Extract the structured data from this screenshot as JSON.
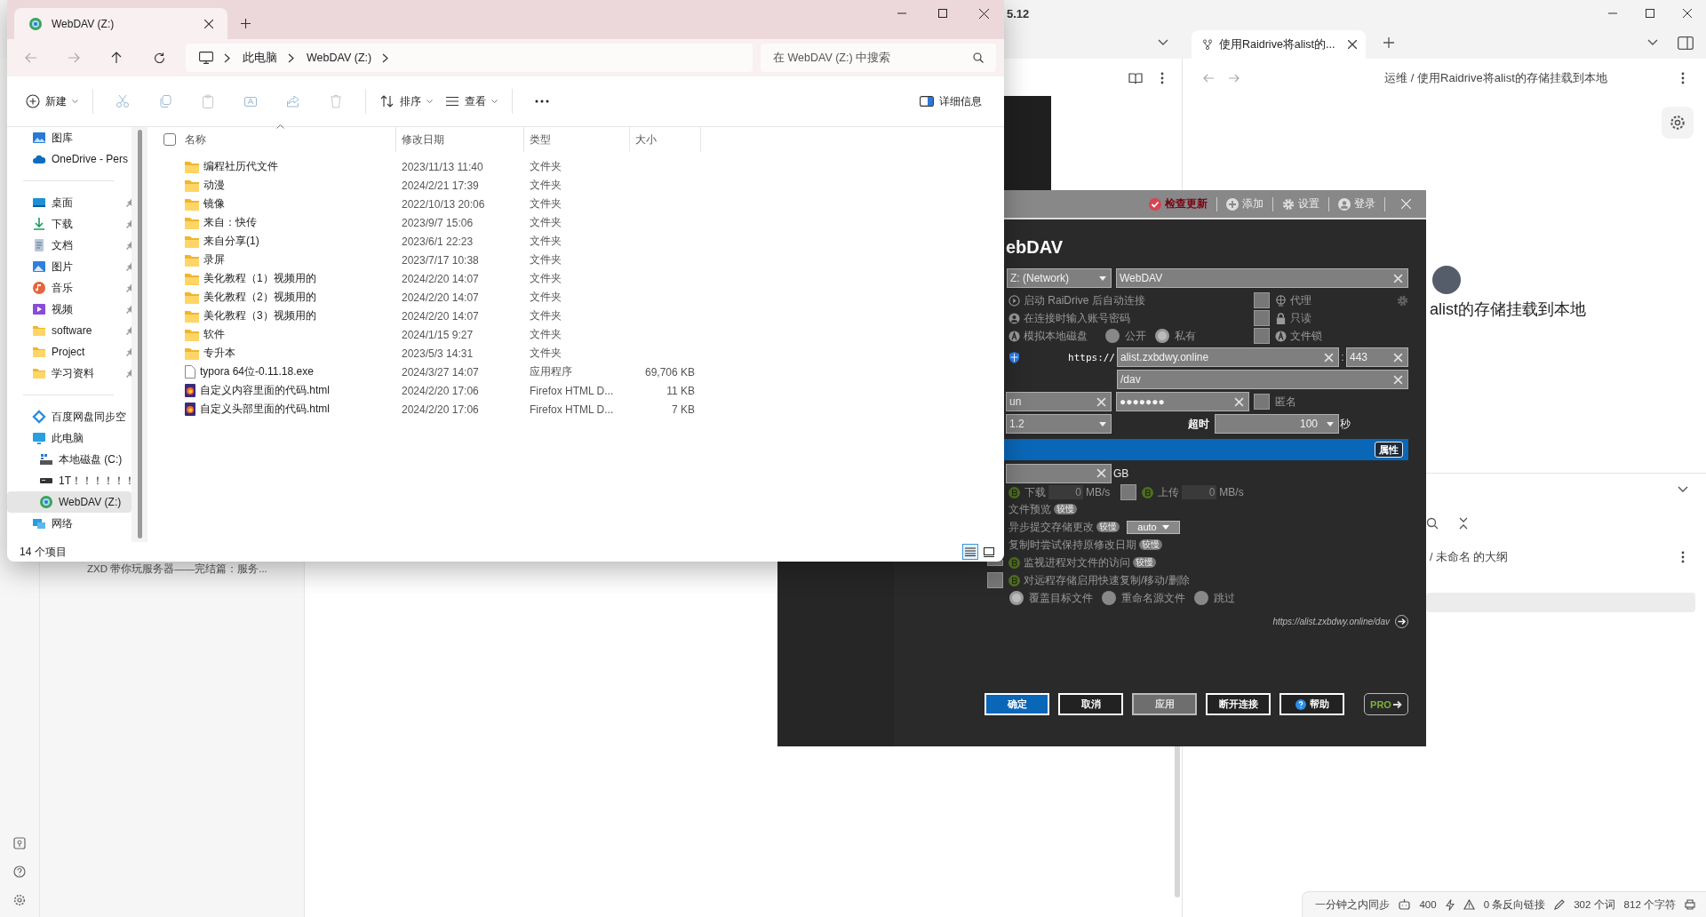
{
  "obsidian": {
    "version": "5.12",
    "tab": "使用Raidrive将alist的...",
    "breadcrumb": "运维 / 使用Raidrive将alist的存储挂载到本地",
    "note_title": "alist的存储挂载到本地",
    "file_item": "ZXD 带你玩服务器——完结篇：服务...",
    "outline_path": "/ 未命名 的大纲",
    "status": {
      "sync": "一分钟之内同步",
      "count": "400",
      "backlinks": "0 条反向链接",
      "words": "302 个词",
      "chars": "812 个字符"
    }
  },
  "explorer": {
    "tab_title": "WebDAV (Z:)",
    "path": [
      "此电脑",
      "WebDAV (Z:)"
    ],
    "search": {
      "placeholder": "在 WebDAV (Z:) 中搜索"
    },
    "toolbar": {
      "new": "新建",
      "sort": "排序",
      "view": "查看",
      "details": "详细信息"
    },
    "nav": [
      {
        "items": [
          {
            "label": "图库",
            "kind": "gallery",
            "pinned": false,
            "selected": false
          },
          {
            "label": "OneDrive - Pers",
            "kind": "cloud",
            "pinned": false,
            "selected": false
          }
        ]
      },
      {
        "items": [
          {
            "label": "桌面",
            "kind": "desktop",
            "pinned": true,
            "selected": false
          },
          {
            "label": "下载",
            "kind": "download",
            "pinned": true,
            "selected": false
          },
          {
            "label": "文档",
            "kind": "document",
            "pinned": true,
            "selected": false
          },
          {
            "label": "图片",
            "kind": "picture",
            "pinned": true,
            "selected": false
          },
          {
            "label": "音乐",
            "kind": "music",
            "pinned": true,
            "selected": false
          },
          {
            "label": "视频",
            "kind": "video",
            "pinned": true,
            "selected": false
          },
          {
            "label": "software",
            "kind": "folder",
            "pinned": true,
            "selected": false
          },
          {
            "label": "Project",
            "kind": "folder",
            "pinned": true,
            "selected": false
          },
          {
            "label": "学习资料",
            "kind": "folder",
            "pinned": true,
            "selected": false
          }
        ]
      },
      {
        "items": [
          {
            "label": "百度网盘同步空",
            "kind": "baidu",
            "pinned": false,
            "selected": false
          },
          {
            "label": "此电脑",
            "kind": "pc",
            "pinned": false,
            "selected": false,
            "children": [
              {
                "label": "本地磁盘 (C:)",
                "kind": "drive",
                "pinned": false,
                "selected": false
              },
              {
                "label": "1T！！！！！！",
                "kind": "usb",
                "pinned": false,
                "selected": false
              },
              {
                "label": "WebDAV (Z:)",
                "kind": "webdav",
                "pinned": false,
                "selected": true
              }
            ]
          },
          {
            "label": "网络",
            "kind": "network",
            "pinned": false,
            "selected": false
          }
        ]
      }
    ],
    "select_all": {
      "checked": false
    },
    "columns": [
      "名称",
      "修改日期",
      "类型",
      "大小"
    ],
    "rows": [
      {
        "name": "编程社历代文件",
        "date": "2023/11/13 11:40",
        "type": "文件夹",
        "kind": "folder"
      },
      {
        "name": "动漫",
        "date": "2024/2/21 17:39",
        "type": "文件夹",
        "kind": "folder"
      },
      {
        "name": "镜像",
        "date": "2022/10/13 20:06",
        "type": "文件夹",
        "kind": "folder"
      },
      {
        "name": "来自：快传",
        "date": "2023/9/7 15:06",
        "type": "文件夹",
        "kind": "folder"
      },
      {
        "name": "来自分享(1)",
        "date": "2023/6/1 22:23",
        "type": "文件夹",
        "kind": "folder"
      },
      {
        "name": "录屏",
        "date": "2023/7/17 10:38",
        "type": "文件夹",
        "kind": "folder"
      },
      {
        "name": "美化教程（1）视频用的",
        "date": "2024/2/20 14:07",
        "type": "文件夹",
        "kind": "folder"
      },
      {
        "name": "美化教程（2）视频用的",
        "date": "2024/2/20 14:07",
        "type": "文件夹",
        "kind": "folder"
      },
      {
        "name": "美化教程（3）视频用的",
        "date": "2024/2/20 14:07",
        "type": "文件夹",
        "kind": "folder"
      },
      {
        "name": "软件",
        "date": "2024/1/15 9:27",
        "type": "文件夹",
        "kind": "folder"
      },
      {
        "name": "专升本",
        "date": "2023/5/3 14:31",
        "type": "文件夹",
        "kind": "folder"
      },
      {
        "name": "typora 64位-0.11.18.exe",
        "date": "2024/3/27 14:07",
        "type": "应用程序",
        "size": "69,706 KB",
        "kind": "exe"
      },
      {
        "name": "自定义内容里面的代码.html",
        "date": "2024/2/20 17:06",
        "type": "Firefox HTML D...",
        "size": "11 KB",
        "kind": "html"
      },
      {
        "name": "自定义头部里面的代码.html",
        "date": "2024/2/20 17:06",
        "type": "Firefox HTML D...",
        "size": "7 KB",
        "kind": "html"
      }
    ],
    "status": "14 个项目",
    "views": [
      {
        "kind": "details",
        "selected": true
      },
      {
        "kind": "tiles",
        "selected": false
      }
    ]
  },
  "raidrive": {
    "toolbar": [
      {
        "label": "检查更新",
        "kind": "update"
      },
      {
        "label": "添加",
        "kind": "add"
      },
      {
        "label": "设置",
        "kind": "settings"
      },
      {
        "label": "登录",
        "kind": "login"
      }
    ],
    "title": "ebDAV",
    "drive": "Z: (Network)",
    "name": "WebDAV",
    "options": [
      {
        "label": "启动 RaiDrive 后自动连接",
        "kind": "play",
        "right": {
          "label": "代理",
          "kind": "globe",
          "checked": false
        }
      },
      {
        "label": "在连接时输入账号密码",
        "kind": "user",
        "right": {
          "label": "只读",
          "kind": "lock",
          "checked": false
        }
      },
      {
        "label": "模拟本地磁盘",
        "kind": "a",
        "right": {
          "label": "文件锁",
          "kind": "a",
          "checked": false
        }
      }
    ],
    "visibility": [
      {
        "label": "公开",
        "selected": false
      },
      {
        "label": "私有",
        "selected": true
      }
    ],
    "scheme": "https://",
    "host": "alist.zxbdwy.online",
    "port_separator": ":",
    "port": "443",
    "path": "/dav",
    "user": "un",
    "password": "●●●●●●●",
    "anonymous": {
      "label": "匿名",
      "checked": false
    },
    "version": "1.2",
    "timeout_label": "超时",
    "timeout": "100",
    "timeout_unit": "秒",
    "properties": "属性",
    "quota_unit": "GB",
    "download": {
      "label": "下载",
      "value": "0",
      "unit": "MB/s"
    },
    "upload_checked": false,
    "upload": {
      "label": "上传",
      "value": "0",
      "unit": "MB/s"
    },
    "advanced": [
      {
        "kind": "plain",
        "label": "文件预览",
        "badge": "较慢"
      },
      {
        "kind": "select",
        "label": "异步提交存储更改",
        "badge": "较慢",
        "value": "auto"
      },
      {
        "kind": "plain",
        "label": "复制时尝试保持原修改日期",
        "badge": "较慢"
      },
      {
        "kind": "check",
        "label": "监视进程对文件的访问",
        "badge": "较慢",
        "checked": false
      },
      {
        "kind": "check",
        "label": "对远程存储启用快速复制/移动/删除",
        "checked": false
      }
    ],
    "conflict": [
      {
        "label": "覆盖目标文件",
        "selected": true
      },
      {
        "label": "重命名源文件",
        "selected": false
      },
      {
        "label": "跳过",
        "selected": false
      }
    ],
    "url": "https://alist.zxbdwy.online/dav",
    "buttons": [
      {
        "label": "确定",
        "kind": "primary"
      },
      {
        "label": "取消",
        "kind": "normal"
      },
      {
        "label": "应用",
        "kind": "disabled"
      },
      {
        "label": "断开连接",
        "kind": "normal"
      },
      {
        "label": "帮助",
        "kind": "help"
      }
    ],
    "pro": "PRO"
  }
}
